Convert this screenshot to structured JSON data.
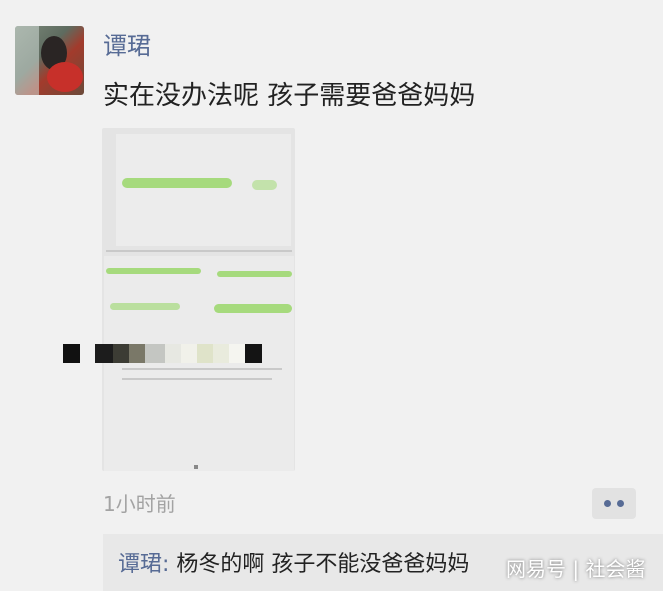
{
  "post": {
    "author": "谭珺",
    "content": "实在没办法呢 孩子需要爸爸妈妈",
    "timestamp": "1小时前",
    "image": {
      "kind": "photo-of-document",
      "icon": "document-photo"
    }
  },
  "comments": [
    {
      "author": "谭珺:",
      "text": "杨冬的啊 孩子不能没爸爸妈妈"
    }
  ],
  "watermark": "网易号 | 社会酱",
  "colors": {
    "link_blue": "#576b95",
    "background": "#f1f1f1",
    "comment_bg": "#e8e8e8",
    "time_gray": "#a3a3a3"
  },
  "icons": {
    "more": "more-dots-icon"
  }
}
